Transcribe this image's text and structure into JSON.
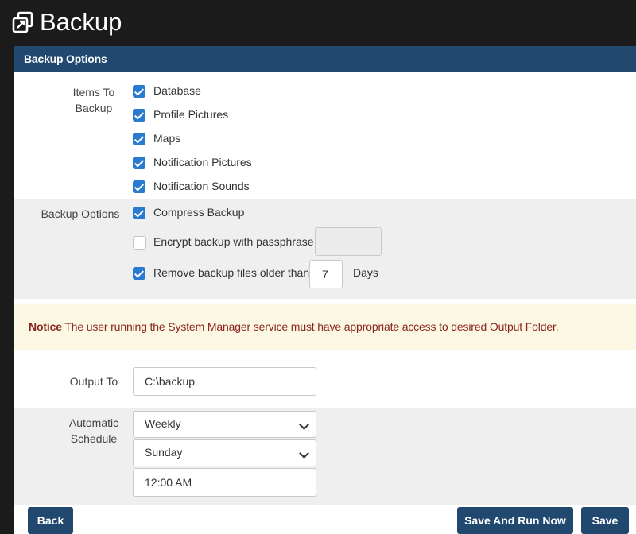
{
  "app": {
    "title": "Backup"
  },
  "panel": {
    "header": "Backup Options"
  },
  "items_to_backup": {
    "label_line1": "Items To",
    "label_line2": "Backup",
    "items": [
      {
        "label": "Database",
        "checked": true
      },
      {
        "label": "Profile Pictures",
        "checked": true
      },
      {
        "label": "Maps",
        "checked": true
      },
      {
        "label": "Notification Pictures",
        "checked": true
      },
      {
        "label": "Notification Sounds",
        "checked": true
      }
    ]
  },
  "backup_options": {
    "label": "Backup Options",
    "compress": {
      "label": "Compress Backup",
      "checked": true
    },
    "encrypt": {
      "label": "Encrypt backup with passphrase",
      "checked": false,
      "value": ""
    },
    "remove_old": {
      "label": "Remove backup files older than",
      "checked": true,
      "days_value": "7",
      "days_unit": "Days"
    }
  },
  "notice": {
    "prefix": "Notice",
    "text": " The user running the System Manager service must have appropriate access to desired Output Folder."
  },
  "output": {
    "label": "Output To",
    "value": "C:\\backup"
  },
  "schedule": {
    "label_line1": "Automatic",
    "label_line2": "Schedule",
    "frequency": "Weekly",
    "day": "Sunday",
    "time": "12:00 AM"
  },
  "buttons": {
    "back": "Back",
    "save_and_run": "Save And Run Now",
    "save": "Save"
  },
  "colors": {
    "header": "#21486f",
    "checkbox": "#2a7ad0",
    "notice_bg": "#fcf8e4",
    "notice_text": "#8a2520"
  }
}
